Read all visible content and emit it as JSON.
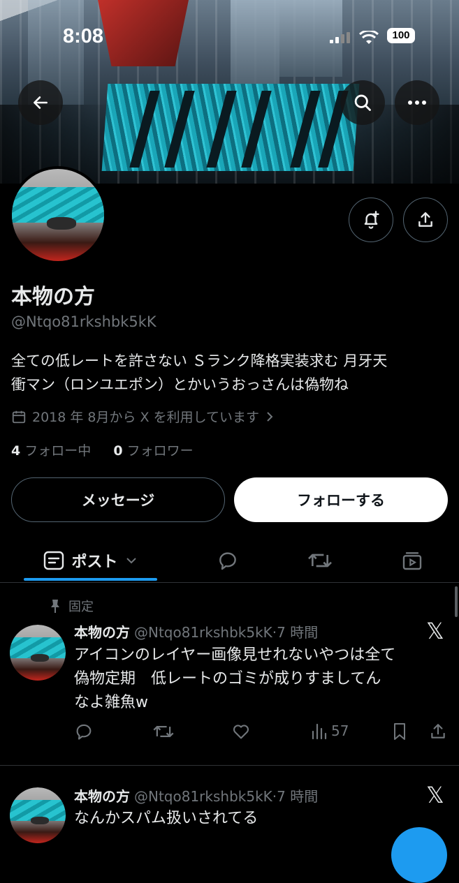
{
  "status_bar": {
    "time": "8:08",
    "battery": "100"
  },
  "profile": {
    "display_name": "本物の方",
    "handle": "@Ntqo81rkshbk5kK",
    "bio_line1": "全ての低レートを許さない Ｓランク降格実装求む 月牙天",
    "bio_line2": "衝マン（ロンユエポン）とかいうおっさんは偽物ね",
    "joined": "2018 年 8月から X を利用しています",
    "following_count": "4",
    "following_label": "フォロー中",
    "followers_count": "0",
    "followers_label": "フォロワー",
    "message_button": "メッセージ",
    "follow_button": "フォローする"
  },
  "tabs": {
    "posts_label": "ポスト"
  },
  "posts": [
    {
      "pinned_label": "固定",
      "name": "本物の方",
      "handle_time": "@Ntqo81rkshbk5kK·7 時間",
      "line1": "アイコンのレイヤー画像見せれないやつは全て",
      "line2": "偽物定期　低レートのゴミが成りすましてん",
      "line3": "なよ雑魚w",
      "views": "57"
    },
    {
      "name": "本物の方",
      "handle_time": "@Ntqo81rkshbk5kK·7 時間",
      "line1": "なんかスパム扱いされてる"
    }
  ],
  "icons": {
    "back": "arrow-left-icon",
    "search": "search-icon",
    "more": "more-icon",
    "notify": "bell-plus-icon",
    "share": "share-icon",
    "calendar": "calendar-icon",
    "reply": "reply-icon",
    "repost": "repost-icon",
    "like": "heart-icon",
    "views": "views-icon",
    "bookmark": "bookmark-icon",
    "pin": "pin-icon",
    "x_logo": "x-logo"
  },
  "colors": {
    "accent": "#1d9bf0",
    "secondary_text": "#71767b",
    "border": "#2f3336"
  }
}
